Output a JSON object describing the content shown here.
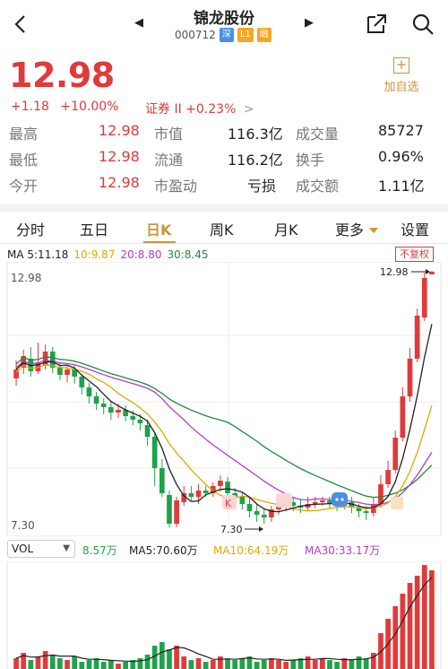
{
  "header": {
    "stock_name": "锦龙股份",
    "stock_code": "000712",
    "tags": [
      {
        "text": "深",
        "color": "#4a90e2"
      },
      {
        "text": "L1",
        "color": "#f5a623"
      },
      {
        "text": "融",
        "color": "#f5a623"
      }
    ],
    "prev_arrow": "◀",
    "next_arrow": "▶"
  },
  "quote": {
    "price": "12.98",
    "change": "+1.18",
    "change_pct": "+10.00%",
    "sector_name": "证券 II",
    "sector_pct": "+0.23%",
    "sector_chevron": ">",
    "add_fav_label": "加自选",
    "add_fav_icon": "+"
  },
  "stats": {
    "rows": [
      [
        {
          "label": "最高",
          "value": "12.98"
        },
        {
          "label": "市值",
          "value": "116.3亿"
        },
        {
          "label": "成交量",
          "value": "85727"
        }
      ],
      [
        {
          "label": "最低",
          "value": "12.98"
        },
        {
          "label": "流通",
          "value": "116.2亿"
        },
        {
          "label": "换手",
          "value": "0.96%"
        }
      ],
      [
        {
          "label": "今开",
          "value": "12.98"
        },
        {
          "label": "市盈动",
          "value": "亏损"
        },
        {
          "label": "成交额",
          "value": "1.11亿"
        }
      ]
    ]
  },
  "tabs": [
    {
      "label": "分时"
    },
    {
      "label": "五日"
    },
    {
      "label": "日K",
      "active": true
    },
    {
      "label": "周K"
    },
    {
      "label": "月K"
    },
    {
      "label": "更多"
    },
    {
      "label": "设置"
    }
  ],
  "ma": {
    "ma5": "MA 5:11.18",
    "ma10": "10:9.87",
    "ma20": "20:8.80",
    "ma30": "30:8.45",
    "adjust_label": "不复权"
  },
  "chart_labels": {
    "high_axis": "12.98",
    "low_axis": "7.30",
    "high_marker": "12.98",
    "low_marker": "7.30"
  },
  "volume": {
    "indicator": "VOL",
    "dropdown_arrow": "▼",
    "vol": "8.57万",
    "ma5": "MA5:70.60万",
    "ma10": "MA10:64.19万",
    "ma30": "MA30:33.17万"
  },
  "colors": {
    "up": "#e03a3a",
    "down": "#1fa34a",
    "accent": "#c9963a",
    "ma5": "#222222",
    "ma10": "#e0a800",
    "ma20": "#b43cc8",
    "ma30": "#1f8a3a"
  }
}
